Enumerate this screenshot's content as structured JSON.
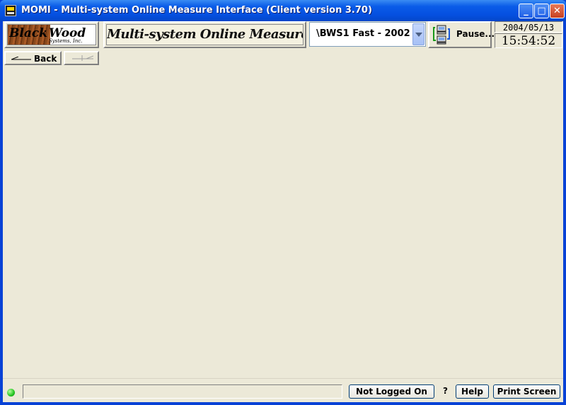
{
  "window": {
    "title": "MOMI - Multi-system Online Measure Interface (Client version 3.70)",
    "icon": "momi-app-icon",
    "controls": {
      "minimize": "_",
      "maximize": "□",
      "close": "✕"
    }
  },
  "logo": {
    "word1": "Black",
    "word2": "Wood",
    "sub": "Systems, Inc."
  },
  "banner": {
    "text": "Multi-system Online Measure Interface"
  },
  "system_selector": {
    "value": "\\BWS1 Fast - 2002"
  },
  "toolbar": {
    "pause_label": "Pause...",
    "date": "2004/05/13",
    "time": "15:54:52"
  },
  "navigation": {
    "back_label": "Back"
  },
  "statusbar": {
    "status_text": "",
    "login_label": "Not Logged On",
    "question": "?",
    "help_label": "Help",
    "print_label": "Print Screen",
    "led_color": "#24c422"
  }
}
